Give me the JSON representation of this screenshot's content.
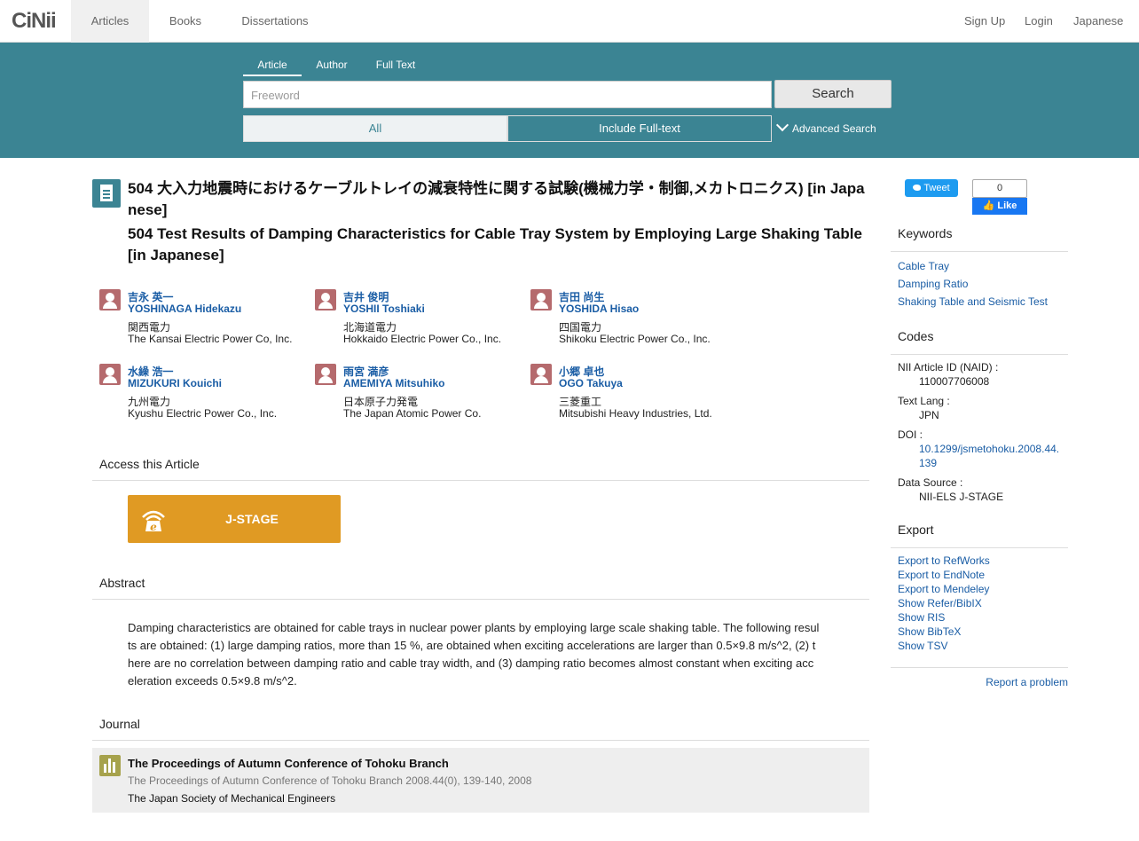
{
  "nav": {
    "logo": "CiNii",
    "tabs": [
      "Articles",
      "Books",
      "Dissertations"
    ],
    "right": [
      "Sign Up",
      "Login",
      "Japanese"
    ]
  },
  "search": {
    "tabs": [
      "Article",
      "Author",
      "Full Text"
    ],
    "placeholder": "Freeword",
    "button": "Search",
    "options": [
      "All",
      "Include Full-text"
    ],
    "advanced": "Advanced Search"
  },
  "article": {
    "title_ja": "504 大入力地震時におけるケーブルトレイの減衰特性に関する試験(機械力学・制御,メカトロニクス)  [in Japanese]",
    "title_en": "504 Test Results of Damping Characteristics for Cable Tray System by Employing Large Shaking Table  [in Japanese]"
  },
  "authors": [
    {
      "name_ja": "吉永 英一",
      "name_en": "YOSHINAGA Hidekazu",
      "aff_ja": "関西電力",
      "aff_en": "The Kansai Electric Power Co, Inc."
    },
    {
      "name_ja": "吉井 俊明",
      "name_en": "YOSHII Toshiaki",
      "aff_ja": "北海道電力",
      "aff_en": "Hokkaido Electric Power Co., Inc."
    },
    {
      "name_ja": "吉田 尚生",
      "name_en": "YOSHIDA Hisao",
      "aff_ja": "四国電力",
      "aff_en": "Shikoku Electric Power Co., Inc."
    },
    {
      "name_ja": "水繰 浩一",
      "name_en": "MIZUKURI Kouichi",
      "aff_ja": "九州電力",
      "aff_en": "Kyushu Electric Power Co., Inc."
    },
    {
      "name_ja": "雨宮 満彦",
      "name_en": "AMEMIYA Mitsuhiko",
      "aff_ja": "日本原子力発電",
      "aff_en": "The Japan Atomic Power Co."
    },
    {
      "name_ja": "小郷 卓也",
      "name_en": "OGO Takuya",
      "aff_ja": "三菱重工",
      "aff_en": "Mitsubishi Heavy Industries, Ltd."
    }
  ],
  "access": {
    "heading": "Access this Article",
    "button": "J-STAGE"
  },
  "abstract": {
    "heading": "Abstract",
    "text": "Damping characteristics are obtained for cable trays in nuclear power plants by employing large scale shaking table. The following results are obtained: (1) large damping ratios, more than 15 %, are obtained when exciting accelerations are larger than 0.5×9.8 m/s^2, (2) there are no correlation between damping ratio and cable tray width, and (3) damping ratio becomes almost constant when exciting acceleration exceeds 0.5×9.8 m/s^2."
  },
  "journal": {
    "heading": "Journal",
    "title": "The Proceedings of Autumn Conference of Tohoku Branch",
    "meta": "The Proceedings of Autumn Conference of Tohoku Branch 2008.44(0), 139-140, 2008",
    "publisher": "The Japan Society of Mechanical Engineers"
  },
  "social": {
    "tweet": "Tweet",
    "like_count": "0",
    "like": "Like"
  },
  "sidebar": {
    "keywords_heading": "Keywords",
    "keywords": [
      "Cable Tray",
      "Damping Ratio",
      "Shaking Table and Seismic Test"
    ],
    "codes_heading": "Codes",
    "naid_label": "NII Article ID (NAID) :",
    "naid": "110007706008",
    "lang_label": "Text Lang :",
    "lang": "JPN",
    "doi_label": "DOI :",
    "doi": "10.1299/jsmetohoku.2008.44.139",
    "source_label": "Data Source :",
    "source": "NII-ELS  J-STAGE",
    "export_heading": "Export",
    "exports": [
      "Export to RefWorks",
      "Export to EndNote",
      "Export to Mendeley",
      "Show Refer/BibIX",
      "Show RIS",
      "Show BibTeX",
      "Show TSV"
    ],
    "report": "Report a problem"
  },
  "colors": {
    "band": "#3b8493",
    "link": "#1a5da5",
    "jstage": "#e09a23",
    "author_icon": "#b56a6d",
    "journal_icon": "#a6a24c"
  }
}
